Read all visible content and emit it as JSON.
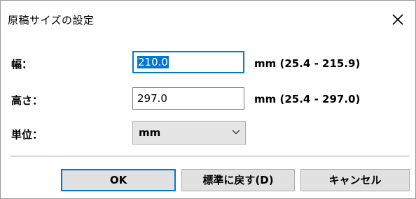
{
  "dialog": {
    "title": "原稿サイズの設定",
    "close_icon": "close-icon"
  },
  "fields": {
    "width": {
      "label": "幅：",
      "value": "210.0",
      "range": "mm (25.4 - 215.9)"
    },
    "height": {
      "label": "高さ：",
      "value": "297.0",
      "range": "mm (25.4 - 297.0)"
    },
    "unit": {
      "label": "単位：",
      "selected": "mm"
    }
  },
  "buttons": {
    "ok": "OK",
    "restore_defaults": "標準に戻す(D)",
    "cancel": "キャンセル"
  },
  "colors": {
    "accent": "#0078d7",
    "button_face": "#e1e1e1",
    "combo_face": "#e5e5e5"
  }
}
